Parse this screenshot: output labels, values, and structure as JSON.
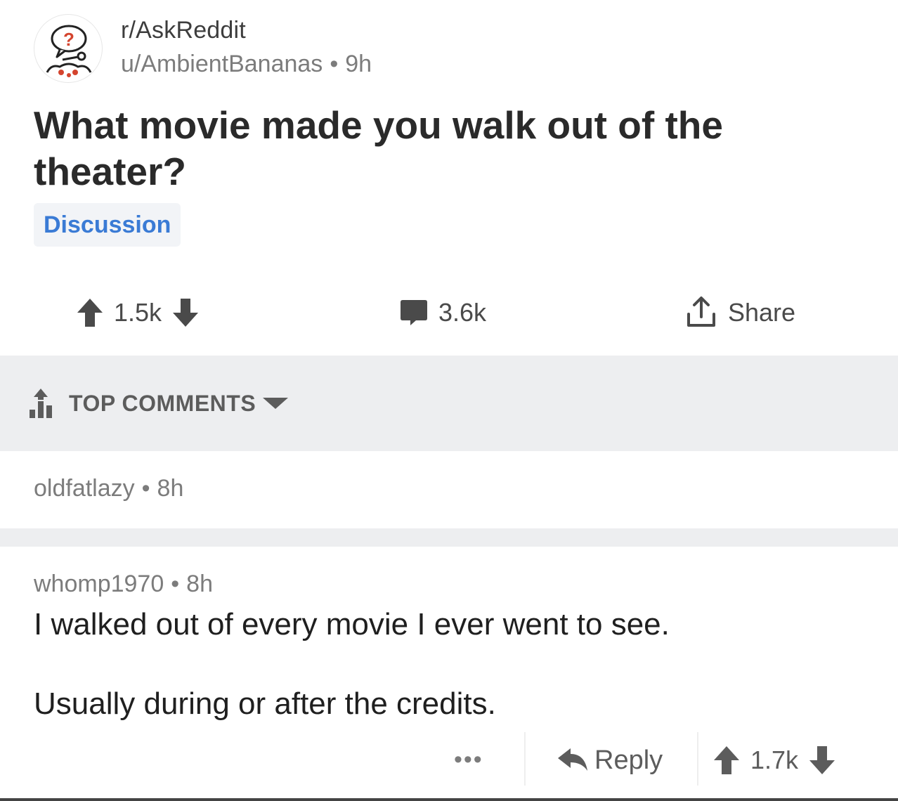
{
  "post": {
    "subreddit": "r/AskReddit",
    "author": "u/AmbientBananas",
    "age": "9h",
    "title": "What movie made you walk out of the theater?",
    "flair": "Discussion",
    "score": "1.5k",
    "comment_count": "3.6k",
    "share_label": "Share"
  },
  "sort": {
    "label": "TOP COMMENTS"
  },
  "comments": [
    {
      "author": "oldfatlazy",
      "age": "8h"
    },
    {
      "author": "whomp1970",
      "age": "8h",
      "body_line1": "I walked out of every movie I ever went to see.",
      "body_line2": "Usually during or after the credits.",
      "more_label": "•••",
      "reply_label": "Reply",
      "score": "1.7k"
    }
  ],
  "separator_dot": "•",
  "colors": {
    "flair_text": "#3a7bd5",
    "sort_bar_bg": "#edeef0",
    "avatar_red": "#d4442e"
  },
  "icons": {
    "avatar": "askreddit-snoo-question-icon",
    "upvote": "arrow-up-icon",
    "downvote": "arrow-down-icon",
    "comments": "speech-bubble-icon",
    "share": "share-upload-icon",
    "sort": "top-bars-icon",
    "caret": "caret-down-icon",
    "reply": "reply-arrow-icon"
  }
}
